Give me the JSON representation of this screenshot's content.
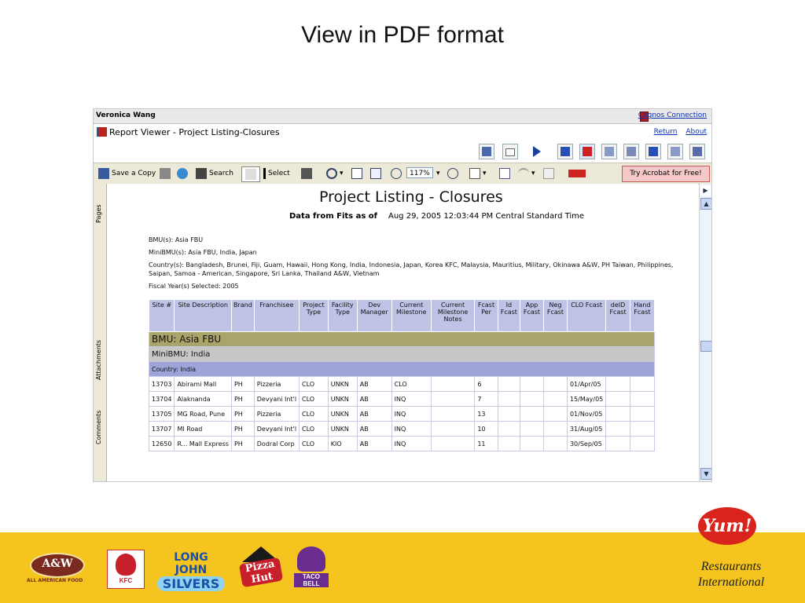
{
  "slide_title": "View in PDF format",
  "app": {
    "user_name": "Veronica Wang",
    "cognos_link": "Cognos Connection",
    "viewer_title": "Report Viewer - Project Listing-Closures",
    "links": {
      "return": "Return",
      "about": "About"
    }
  },
  "toolbar": {
    "save_copy": "Save a Copy",
    "search": "Search",
    "select": "Select",
    "zoom": "117%",
    "acrobat": "Try Acrobat for Free!"
  },
  "side_tabs": {
    "pages": "Pages",
    "attachments": "Attachments",
    "comments": "Comments"
  },
  "report": {
    "title": "Project Listing  - Closures",
    "subtitle_label": "Data from Fits as of",
    "subtitle_date": "Aug 29, 2005 12:03:44 PM  Central Standard Time",
    "bmus": "BMU(s): Asia FBU",
    "minibmus": "MiniBMU(s): Asia FBU, India, Japan",
    "countries": "Country(s): Bangladesh, Brunei, Fiji, Guam, Hawaii, Hong Kong, India, Indonesia, Japan, Korea KFC, Malaysia, Mauritius, Military, Okinawa A&W, PH Taiwan, Philippines, Saipan, Samoa - American, Singapore, Sri Lanka, Thailand A&W, Vietnam",
    "fiscal_year": "Fiscal Year(s) Selected: 2005",
    "columns": [
      "Site #",
      "Site Description",
      "Brand",
      "Franchisee",
      "Project Type",
      "Facility Type",
      "Dev Manager",
      "Current Milestone",
      "Current Milestone Notes",
      "Fcast Per",
      "Id Fcast",
      "App Fcast",
      "Neg Fcast",
      "CLO Fcast",
      "deID Fcast",
      "Hand Fcast"
    ],
    "group_bmu": "BMU: Asia FBU",
    "group_minibmu": "MiniBMU: India",
    "group_country": "Country: India",
    "rows": [
      [
        "13703",
        "Abirami Mall",
        "PH",
        "Pizzeria",
        "CLO",
        "UNKN",
        "AB",
        "CLO",
        "",
        "6",
        "",
        "",
        "",
        "01/Apr/05",
        "",
        ""
      ],
      [
        "13704",
        "Alaknanda",
        "PH",
        "Devyani Int'l",
        "CLO",
        "UNKN",
        "AB",
        "INQ",
        "",
        "7",
        "",
        "",
        "",
        "15/May/05",
        "",
        ""
      ],
      [
        "13705",
        "MG Road, Pune",
        "PH",
        "Pizzeria",
        "CLO",
        "UNKN",
        "AB",
        "INQ",
        "",
        "13",
        "",
        "",
        "",
        "01/Nov/05",
        "",
        ""
      ],
      [
        "13707",
        "MI Road",
        "PH",
        "Devyani Int'l",
        "CLO",
        "UNKN",
        "AB",
        "INQ",
        "",
        "10",
        "",
        "",
        "",
        "31/Aug/05",
        "",
        ""
      ],
      [
        "12650",
        "R... Mall Express",
        "PH",
        "Dodral Corp",
        "CLO",
        "KIO",
        "AB",
        "INQ",
        "",
        "11",
        "",
        "",
        "",
        "30/Sep/05",
        "",
        ""
      ]
    ]
  },
  "brands": {
    "aw": "A&W",
    "aw_tag": "ALL AMERICAN FOOD",
    "kfc": "KFC",
    "ljs_line1": "LONG JOHN",
    "ljs_line2": "SILVERS",
    "pizza_hut": "Pizza Hut",
    "taco_bell": "TACO BELL",
    "yum": "Yum!",
    "yum_line1": "Restaurants",
    "yum_line2": "International"
  }
}
